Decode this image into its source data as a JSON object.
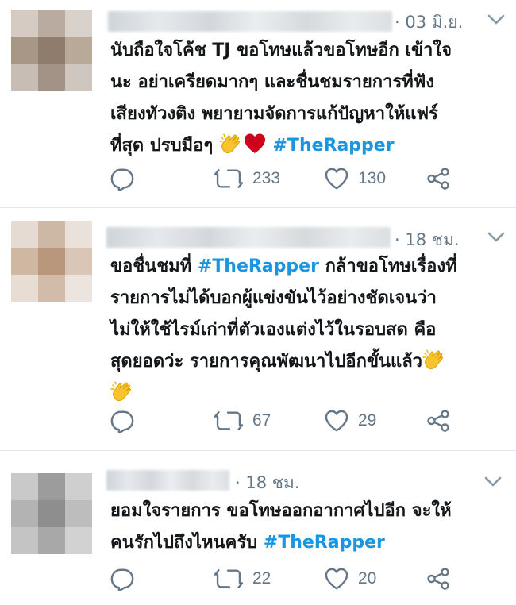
{
  "tweets": [
    {
      "time": "· 03 มิ.ย.",
      "lines": [
        "นับถือใจโค้ช TJ ขอโทษแล้วขอโทษอีก เข้าใจ",
        "นะ อย่าเครียดมากๆ และชื่นชมรายการที่ฟัง",
        "เสียงทัวงติง พยายามจัดการแก้ปัญหาให้แฟร์",
        "ที่สุด ปรบมือๆ"
      ],
      "hashtag": "#TheRapper",
      "emojis": [
        "clapping-hands",
        "red-heart"
      ],
      "replies": "",
      "retweets": "233",
      "likes": "130"
    },
    {
      "time": "· 18 ชม.",
      "lines_before": [
        "ขอชื่นชมที่"
      ],
      "hashtag": "#TheRapper",
      "line1_after": "กล้าขอโทษเรื่องที่",
      "lines": [
        "รายการไม่ได้บอกผู้แข่งขันไว้อย่างชัดเจนว่า",
        "ไม่ให้ใช้ไรม์เก่าที่ตัวเองแต่งไว้ในรอบสด คือ",
        "สุดยอดว่ะ รายการคุณพัฒนาไปอีกขั้นแล้ว"
      ],
      "emojis": [
        "clapping-hands",
        "clapping-hands"
      ],
      "replies": "",
      "retweets": "67",
      "likes": "29"
    },
    {
      "time": "· 18 ชม.",
      "lines": [
        "ยอมใจรายการ ขอโทษออกอากาศไปอีก จะให้",
        "คนรักไปถึงไหนครับ"
      ],
      "hashtag": "#TheRapper",
      "emojis": [],
      "replies": "",
      "retweets": "22",
      "likes": "20"
    }
  ],
  "colors": {
    "text": "#14171a",
    "muted": "#657786",
    "hashtag": "#1b95e0",
    "divider": "#e1e8ed",
    "heart": "#d0021b",
    "clap": "#f7c32e"
  },
  "icons": [
    "reply-icon",
    "retweet-icon",
    "like-icon",
    "share-icon",
    "chevron-down-icon"
  ]
}
